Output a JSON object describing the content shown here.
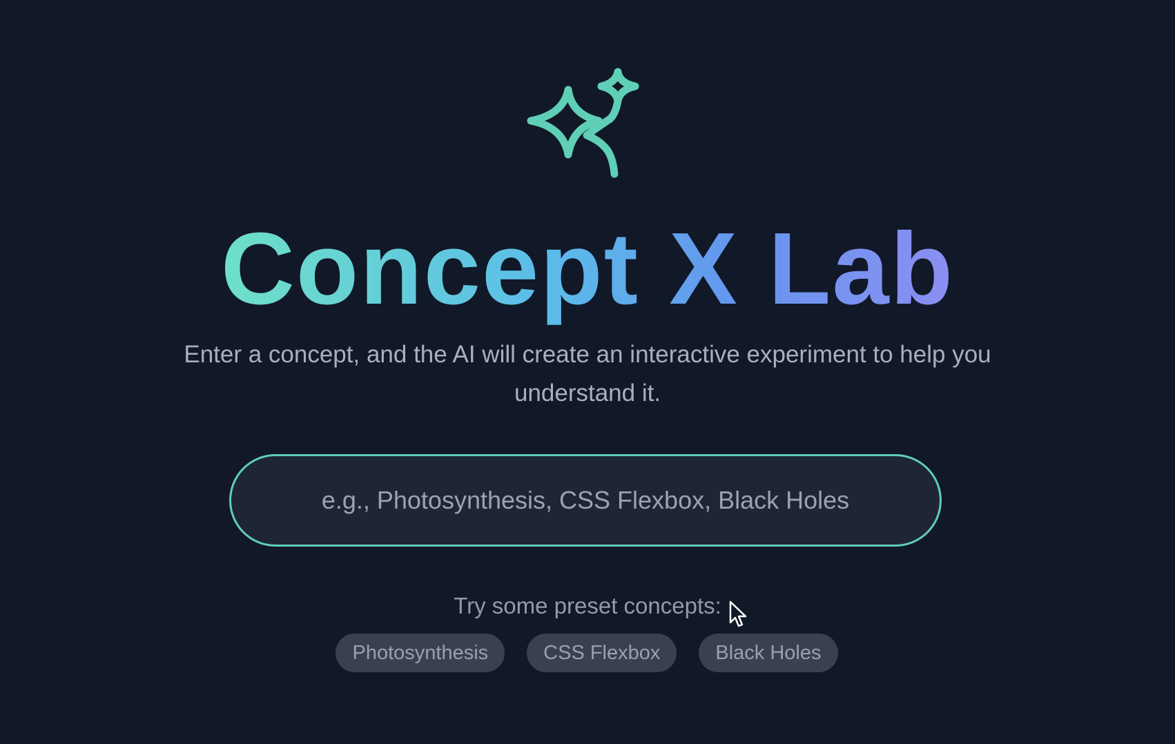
{
  "header": {
    "logo_icon": "sparkles-icon",
    "title": "Concept X Lab",
    "subtitle": "Enter a concept, and the AI will create an interactive experiment to help you understand it."
  },
  "search": {
    "value": "",
    "placeholder": "e.g., Photosynthesis, CSS Flexbox, Black Holes"
  },
  "presets": {
    "label": "Try some preset concepts:",
    "items": [
      {
        "label": "Photosynthesis"
      },
      {
        "label": "CSS Flexbox"
      },
      {
        "label": "Black Holes"
      }
    ]
  },
  "colors": {
    "background": "#111827",
    "accent": "#5fcfb6",
    "gradient_start": "#6ee0c7",
    "gradient_end": "#8b8ff2"
  }
}
